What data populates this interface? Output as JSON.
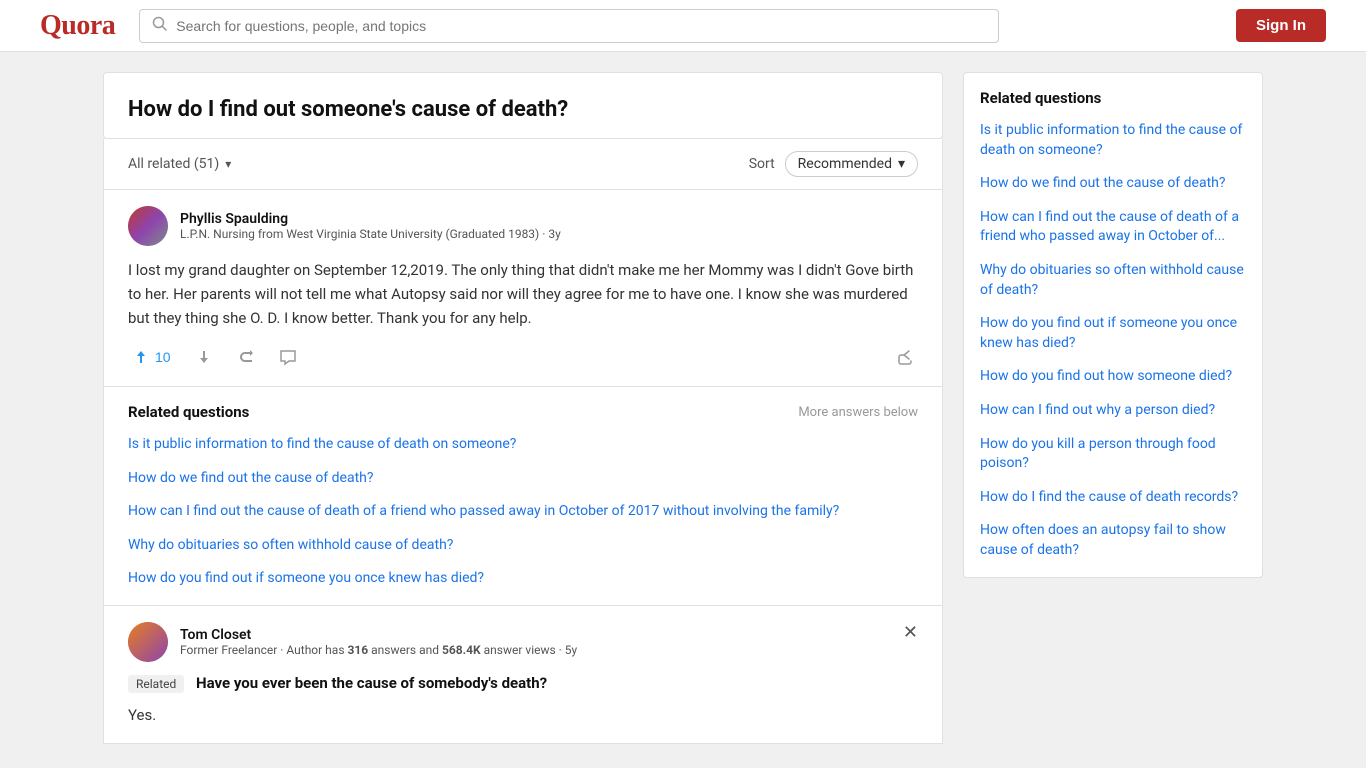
{
  "header": {
    "logo": "Quora",
    "search_placeholder": "Search for questions, people, and topics",
    "sign_in_label": "Sign In"
  },
  "question": {
    "title": "How do I find out someone's cause of death?"
  },
  "all_related": {
    "label": "All related (51)",
    "sort_label": "Sort",
    "recommended_label": "Recommended",
    "chevron": "▾"
  },
  "answer1": {
    "author_name": "Phyllis Spaulding",
    "author_cred": "L.P.N. Nursing from West Virginia State University (Graduated 1983) · 3y",
    "text": "I lost my grand daughter on September 12,2019. The only thing that didn't make me her Mommy was I didn't Gove birth to her. Her parents will not tell me what Autopsy said nor will they agree for me to have one. I know she was murdered but they thing she O. D. I know better. Thank you for any help.",
    "upvote_count": "10"
  },
  "related_questions_inline": {
    "title": "Related questions",
    "more_answers": "More answers below",
    "questions": [
      "Is it public information to find the cause of death on someone?",
      "How do we find out the cause of death?",
      "How can I find out the cause of death of a friend who passed away in October of 2017 without involving the family?",
      "Why do obituaries so often withhold cause of death?",
      "How do you find out if someone you once knew has died?"
    ]
  },
  "answer2": {
    "author_name": "Tom Closet",
    "author_cred_prefix": "Former Freelancer · Author has ",
    "answers_count": "316",
    "author_cred_mid": " answers and ",
    "views_count": "568.4K",
    "author_cred_suffix": " answer views · 5y",
    "related_badge": "Related",
    "related_question": "Have you ever been the cause of somebody's death?",
    "text": "Yes."
  },
  "sidebar": {
    "title": "Related questions",
    "questions": [
      "Is it public information to find the cause of death on someone?",
      "How do we find out the cause of death?",
      "How can I find out the cause of death of a friend who passed away in October of...",
      "Why do obituaries so often withhold cause of death?",
      "How do you find out if someone you once knew has died?",
      "How do you find out how someone died?",
      "How can I find out why a person died?",
      "How do you kill a person through food poison?",
      "How do I find the cause of death records?",
      "How often does an autopsy fail to show cause of death?"
    ]
  }
}
